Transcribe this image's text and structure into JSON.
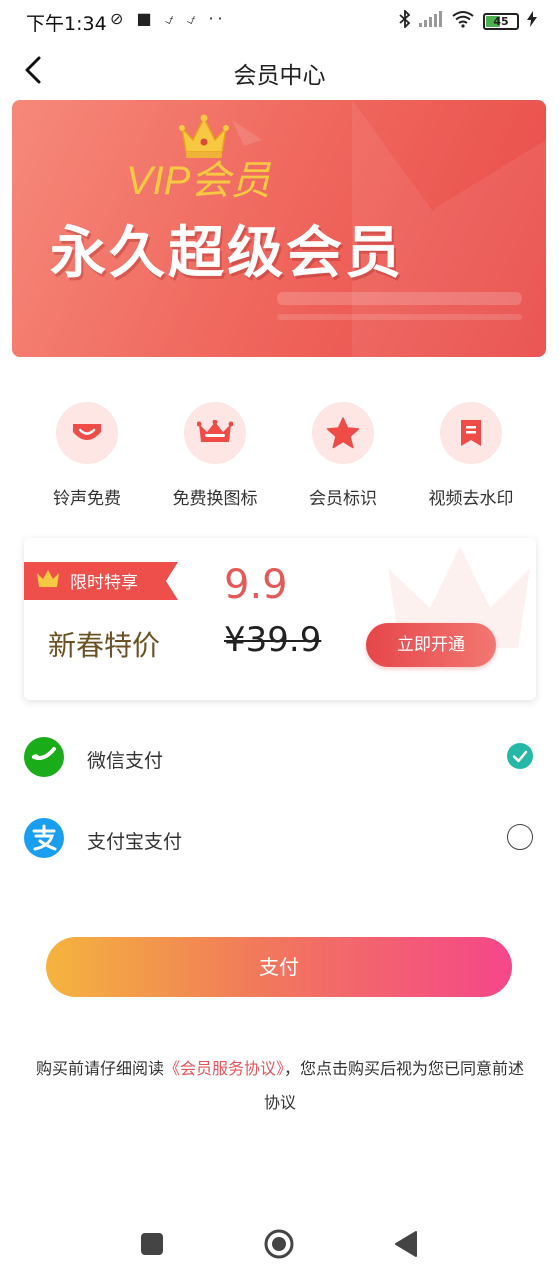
{
  "status_bar": {
    "time": "下午1:34",
    "left_icons": "⊘ ■ ⍻ ⍻ ··",
    "battery_level": "45",
    "battery_color": "#4caf50"
  },
  "header": {
    "title": "会员中心",
    "back_icon": "chevron-left-icon"
  },
  "banner": {
    "vip_label": "VIP会员",
    "main_title": "永久超级会员",
    "crown_icon": "crown-icon",
    "gradient": [
      "#f6897a",
      "#e94a48"
    ]
  },
  "features": [
    {
      "label": "铃声免费",
      "icon": "ribbon-icon"
    },
    {
      "label": "免费换图标",
      "icon": "crown-icon"
    },
    {
      "label": "会员标识",
      "icon": "star-icon"
    },
    {
      "label": "视频去水印",
      "icon": "bookmark-icon"
    }
  ],
  "promo": {
    "ribbon_label": "限时特享",
    "title": "新春特价",
    "price": "9.9",
    "original_price": "¥39.9",
    "button_label": "立即开通"
  },
  "payment": {
    "options": [
      {
        "label": "微信支付",
        "icon": "wechat-icon",
        "selected": true
      },
      {
        "label": "支付宝支付",
        "icon": "alipay-icon",
        "selected": false
      }
    ],
    "pay_button": "支付"
  },
  "agreement": {
    "prefix": "购买前请仔细阅读",
    "link": "《会员服务协议》",
    "suffix": "，您点击购买后视为您已同意前述协议"
  },
  "colors": {
    "accent": "#e35a58",
    "check": "#26b8a6",
    "wechat": "#1aad19",
    "alipay": "#1a9ff0"
  }
}
